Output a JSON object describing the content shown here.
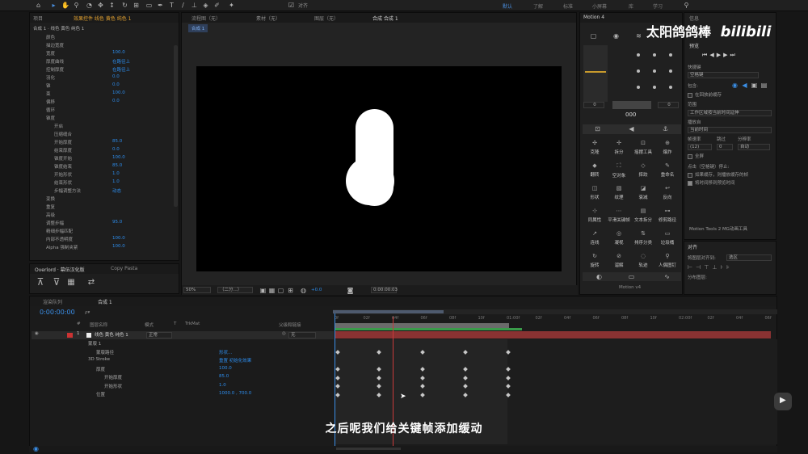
{
  "toolbar": {
    "snap_label": "对齐",
    "workspaces": [
      "默认",
      "了解",
      "标准",
      "小屏幕",
      "库",
      "学习"
    ],
    "active_workspace": 0
  },
  "watermark": {
    "uploader": "太阳鸽鸽棒",
    "site": "bilibili"
  },
  "left_panel": {
    "tabs": [
      "项目",
      "效果控件 线色 黄色 纯色 1"
    ],
    "header": "合成 1 · 线色 黄色 纯色 1",
    "props": [
      {
        "label": "颜色",
        "value": ""
      },
      {
        "label": "描边宽度",
        "value": ""
      },
      {
        "label": "宽度",
        "value": "100.0"
      },
      {
        "label": "厚度曲线",
        "value": "在路径上"
      },
      {
        "label": "控制厚度",
        "value": "在路径上"
      },
      {
        "label": "羽化",
        "value": "0.0"
      },
      {
        "label": "锥",
        "value": "0.0"
      },
      {
        "label": "束",
        "value": "100.0"
      },
      {
        "label": "偏移",
        "value": "0.0"
      },
      {
        "label": "循环",
        "value": ""
      },
      {
        "label": "锥度",
        "value": ""
      },
      {
        "label": "开启",
        "value": ""
      },
      {
        "label": "压缩缝合",
        "value": ""
      },
      {
        "label": "开始厚度",
        "value": "85.0"
      },
      {
        "label": "结束厚度",
        "value": "0.0"
      },
      {
        "label": "锥度开始",
        "value": "100.0"
      },
      {
        "label": "锥度结束",
        "value": "85.0"
      },
      {
        "label": "开始形状",
        "value": "1.0"
      },
      {
        "label": "结束形状",
        "value": "1.0"
      },
      {
        "label": "步幅调整方法",
        "value": "动态"
      },
      {
        "label": "变换",
        "value": ""
      },
      {
        "label": "重复",
        "value": ""
      },
      {
        "label": "高级",
        "value": ""
      },
      {
        "label": "调整步幅",
        "value": "95.0"
      },
      {
        "label": "精细步幅匹配",
        "value": ""
      },
      {
        "label": "内部不透明度",
        "value": "100.0"
      },
      {
        "label": "Alpha 强制夹紧",
        "value": "100.0"
      }
    ],
    "bottom_tabs": [
      "Overlord · 幕伍汉化版",
      "Copy Pasta"
    ]
  },
  "viewer": {
    "tabs": [
      "流程图（无）",
      "素材（无）",
      "图层（无）",
      "合成 合成 1"
    ],
    "comp_chip": "合成 1",
    "zoom": "50%",
    "resolution": "（二分...）",
    "exposure": "+0.0",
    "timecode": "0:00:00:03"
  },
  "motion": {
    "title": "Motion 4",
    "num_left": "0",
    "num_right": "0",
    "num_center": "000",
    "buttons": [
      {
        "icon": "✣",
        "label": "克隆"
      },
      {
        "icon": "✢",
        "label": "拆分"
      },
      {
        "icon": "⊡",
        "label": "摇摆工具"
      },
      {
        "icon": "⊕",
        "label": "爆炸"
      },
      {
        "icon": "◆",
        "label": "翻转"
      },
      {
        "icon": "⛶",
        "label": "空对象"
      },
      {
        "icon": "◇",
        "label": "摔跤"
      },
      {
        "icon": "✎",
        "label": "重命名"
      },
      {
        "icon": "◫",
        "label": "形状"
      },
      {
        "icon": "▧",
        "label": "纹理"
      },
      {
        "icon": "◪",
        "label": "衰减"
      },
      {
        "icon": "↩",
        "label": "反向"
      },
      {
        "icon": "⊹",
        "label": "同属性"
      },
      {
        "icon": "⋯",
        "label": "平滑关键帧"
      },
      {
        "icon": "▤",
        "label": "文本拆分"
      },
      {
        "icon": "⊶",
        "label": "修剪路径"
      },
      {
        "icon": "↗",
        "label": "连线"
      },
      {
        "icon": "◎",
        "label": "凝视"
      },
      {
        "icon": "⇅",
        "label": "排序分类"
      },
      {
        "icon": "▭",
        "label": "垃圾桶"
      },
      {
        "icon": "↻",
        "label": "旋转"
      },
      {
        "icon": "⊘",
        "label": "溜解"
      },
      {
        "icon": "◌",
        "label": "轨迹"
      },
      {
        "icon": "⚲",
        "label": "人偶图钉"
      }
    ],
    "footer": "Motion v4"
  },
  "right_panel": {
    "tabs": [
      "信息",
      "预览"
    ],
    "shortcut_label": "快捷键",
    "shortcut_value": "空格键",
    "include_label": "包含:",
    "cache_label": "在回放前缓存",
    "range_label": "范围",
    "range_value": "工作区域按当前时间延伸",
    "play_from_label": "播放自",
    "play_from_value": "当前时间",
    "fps_label": "帧速率",
    "skip_label": "跳过",
    "res_label": "分辨率",
    "fps_value": "(12)",
    "skip_value": "0",
    "res_value": "自动",
    "fullscreen_label": "全屏",
    "click_stop_label": "点击（空格键）停止:",
    "cache_stop_label": "如果缓存，则播放缓存的帧",
    "move_time_label": "将时间移到预览时间",
    "mg_label": "Motion Tools 2 MG动画工具",
    "align_tab": "对齐",
    "align_to_label": "将图层对齐到:",
    "align_to_value": "选区",
    "distribute_label": "分布图层:"
  },
  "timeline": {
    "tabs": [
      "渲染队列",
      "合成 1"
    ],
    "timecode": "0:00:00:00",
    "search_placeholder": "ρ▾",
    "headers": [
      "#",
      "图层名称",
      "模式",
      "T",
      "TrkMat",
      "父级和链接"
    ],
    "ruler": [
      "0f",
      "02f",
      "04f",
      "06f",
      "08f",
      "10f",
      "01:00f",
      "02f",
      "04f",
      "06f",
      "08f",
      "10f",
      "02:00f",
      "02f",
      "04f",
      "06f"
    ],
    "layer": {
      "num": "1",
      "name": "线色 黄色 纯色 1",
      "mode": "正常",
      "parent": "无"
    },
    "rows": [
      {
        "indent": 0,
        "label": "蒙版 1",
        "value": ""
      },
      {
        "indent": 1,
        "label": "蒙版路径",
        "value": "形状..."
      },
      {
        "indent": 0,
        "label": "3D Stroke",
        "value": "重置  初始化效果"
      },
      {
        "indent": 1,
        "label": "厚度",
        "value": "100.0"
      },
      {
        "indent": 2,
        "label": "开始厚度",
        "value": "85.0"
      },
      {
        "indent": 2,
        "label": "开始形状",
        "value": "1.0"
      },
      {
        "indent": 1,
        "label": "位置",
        "value": "1000.0 , 700.0"
      }
    ]
  },
  "subtitle": "之后呢我们给关键帧添加缓动",
  "colors": {
    "accent": "#2d8ceb",
    "layer_bar": "#8a3232",
    "work_area": "#4d6fa8",
    "playhead": "#c83b3b"
  }
}
